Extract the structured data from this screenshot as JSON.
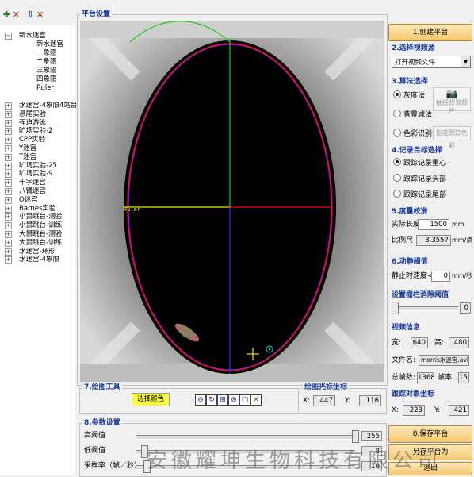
{
  "toolbar": {
    "icons": [
      "add-icon",
      "delete-icon",
      "import-icon",
      "close-icon"
    ]
  },
  "tree": {
    "root": "新水迷宫",
    "children": [
      "新水迷宫",
      "一象限",
      "二象限",
      "三象限",
      "四象限",
      "Ruler"
    ],
    "items": [
      "水迷宫-4象限4站台",
      "悬尾实验",
      "强迫游泳",
      "旷场实验-2",
      "CPP实验",
      "Y迷宫",
      "T迷宫",
      "旷场实验-25",
      "旷场实验-9",
      "十字迷宫",
      "八臂迷宫",
      "O迷宫",
      "Barnes实验",
      "小鼠跳台-测验",
      "小鼠跳台-训练",
      "大鼠跳台-测验",
      "大鼠跳台-训练",
      "水迷宫-环形",
      "水迷宫-4象限"
    ]
  },
  "platform": {
    "title": "平台设置",
    "ruler_label": "Ruler"
  },
  "drawing": {
    "title": "7.绘图工具",
    "color_button": "选择颜色",
    "tool_icons": [
      "circle-tool-icon",
      "rotate-tool-icon",
      "line-tool-icon",
      "color-tool-icon",
      "rect-tool-icon",
      "delete-tool-icon"
    ]
  },
  "cursor": {
    "title": "绘图光标坐标",
    "x_label": "X:",
    "x": "447",
    "y_label": "Y:",
    "y": "116"
  },
  "params": {
    "title": "8.参数设置",
    "rows": [
      {
        "label": "高阈值",
        "value": "255"
      },
      {
        "label": "低阈值",
        "value": "8"
      },
      {
        "label": "采样率（帧／秒）",
        "value": "10"
      }
    ]
  },
  "right": {
    "create_button": "1.创建平台",
    "video_title": "2.选择视频源",
    "video_select": "打开视频文件",
    "algo_title": "3.算法选择",
    "algo_options": [
      "灰度法",
      "背景减法",
      "色彩识别法"
    ],
    "bg_button": "抽摇背景照片",
    "color_button": "指定跟踪色彩",
    "record_title": "4.记录目标选择",
    "record_options": [
      "跟踪记录重心",
      "跟踪记录头部",
      "跟踪记录尾部"
    ],
    "scale_title": "5.度量校准",
    "actual_label": "实际长度:",
    "actual_value": "1500",
    "actual_unit": "mm",
    "ratio_label": "比例尺",
    "ratio_value": "3.3557",
    "ratio_unit": "mm/点",
    "motion_title": "6.动静阈值",
    "rest_label": "静止时速度<",
    "rest_value": "0",
    "rest_unit": "mm/秒",
    "fence_title": "设置栅栏消除阈值",
    "fence_value": "0",
    "video_info_title": "视频信息",
    "width_label": "宽:",
    "width_value": "640",
    "height_label": "高:",
    "height_value": "480",
    "file_label": "文件名:",
    "file_value": "morris水迷宫.avi",
    "frames_label": "总帧数:",
    "frames_value": "1368",
    "rate_label": "帧率:",
    "rate_value": "15",
    "target_title": "跟踪对象坐标",
    "tx_label": "X:",
    "tx_value": "223",
    "ty_label": "Y:",
    "ty_value": "421",
    "save_button": "8.保存平台",
    "save_as_button": "另存平台为",
    "exit_button": "退出"
  },
  "watermark": "安徽耀坤生物科技有限公司",
  "colors": {
    "title_blue": "#1a3a9a",
    "button_fill": "#f5c86e",
    "circle": "#e01010",
    "crosshair_green": "#22cc22",
    "crosshair_yellow": "#e8e020",
    "crosshair_blue": "#3030ff"
  }
}
